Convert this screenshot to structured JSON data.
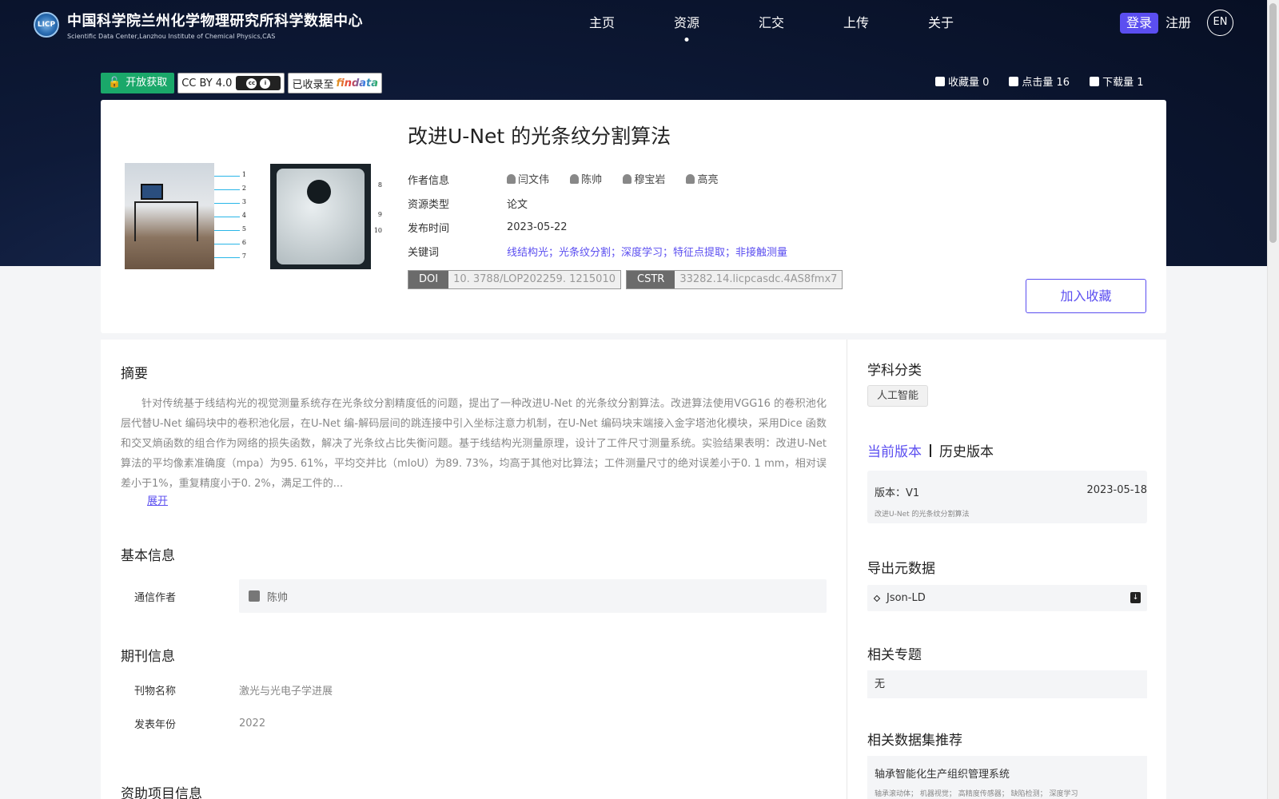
{
  "header": {
    "logo_badge": "LICP",
    "site_name_cn": "中国科学院兰州化学物理研究所科学数据中心",
    "site_name_en": "Scientific Data Center,Lanzhou Institute of Chemical Physics,CAS",
    "nav": [
      "主页",
      "资源",
      "汇交",
      "上传",
      "关于"
    ],
    "active_nav": "资源",
    "login": "登录",
    "register": "注册",
    "lang": "EN"
  },
  "badges": {
    "open_access": "开放获取",
    "license": "CC BY 4.0",
    "findata_prefix": "已收录至",
    "findata_logo": "findata"
  },
  "stats": {
    "favorites": "收藏量 0",
    "views": "点击量 16",
    "downloads": "下载量 1"
  },
  "figure_labels": {
    "left": [
      "1",
      "2",
      "3",
      "4",
      "5",
      "6",
      "7"
    ],
    "right": [
      "8",
      "9",
      "10"
    ]
  },
  "record": {
    "title": "改进U-Net 的光条纹分割算法",
    "author_label": "作者信息",
    "authors": [
      "闫文伟",
      "陈帅",
      "穆宝岩",
      "高亮"
    ],
    "type_label": "资源类型",
    "type_value": "论文",
    "date_label": "发布时间",
    "date_value": "2023-05-22",
    "keywords_label": "关键词",
    "keywords": "线结构光；光条纹分割；深度学习；特征点提取；非接触测量",
    "doi_label": "DOI",
    "doi_value": "10. 3788/LOP202259. 1215010",
    "cstr_label": "CSTR",
    "cstr_value": "33282.14.licpcasdc.4AS8fmx7",
    "favorite_button": "加入收藏"
  },
  "main": {
    "abstract_title": "摘要",
    "abstract_text": "针对传统基于线结构光的视觉测量系统存在光条纹分割精度低的问题，提出了一种改进U-Net 的光条纹分割算法。改进算法使用VGG16 的卷积池化层代替U-Net 编码块中的卷积池化层，在U-Net 编-解码层间的跳连接中引入坐标注意力机制，在U-Net 编码块末端接入金字塔池化模块，采用Dice 函数和交叉熵函数的组合作为网络的损失函数，解决了光条纹占比失衡问题。基于线结构光测量原理，设计了工件尺寸测量系统。实验结果表明：改进U-Net 算法的平均像素准确度（mpa）为95. 61%，平均交并比（mIoU）为89. 73%，均高于其他对比算法；工件测量尺寸的绝对误差小于0. 1 mm，相对误差小于1%，重复精度小于0. 2%，满足工件的...",
    "expand": "展开",
    "basic_title": "基本信息",
    "corresponding_label": "通信作者",
    "corresponding_value": "陈帅",
    "journal_title": "期刊信息",
    "journal_name_label": "刊物名称",
    "journal_name_value": "激光与光电子学进展",
    "year_label": "发表年份",
    "year_value": "2022",
    "funding_title": "资助项目信息"
  },
  "side": {
    "subject_title": "学科分类",
    "subject_tag": "人工智能",
    "current_version": "当前版本",
    "history_version": "历史版本",
    "version_label": "版本：V1",
    "version_date": "2023-05-18",
    "version_name": "改进U-Net 的光条纹分割算法",
    "export_title": "导出元数据",
    "export_format": "Json-LD",
    "topics_title": "相关专题",
    "topics_value": "无",
    "recommend_title": "相关数据集推荐",
    "recommend_name": "轴承智能化生产组织管理系统",
    "recommend_keywords": "轴承滚动体；  机器视觉；  高精度传感器；  缺陷检测；  深度学习"
  },
  "colors": {
    "accent": "#5b4ef0",
    "open_green": "#1aa86a",
    "hero_bg": "#0e1a38"
  }
}
